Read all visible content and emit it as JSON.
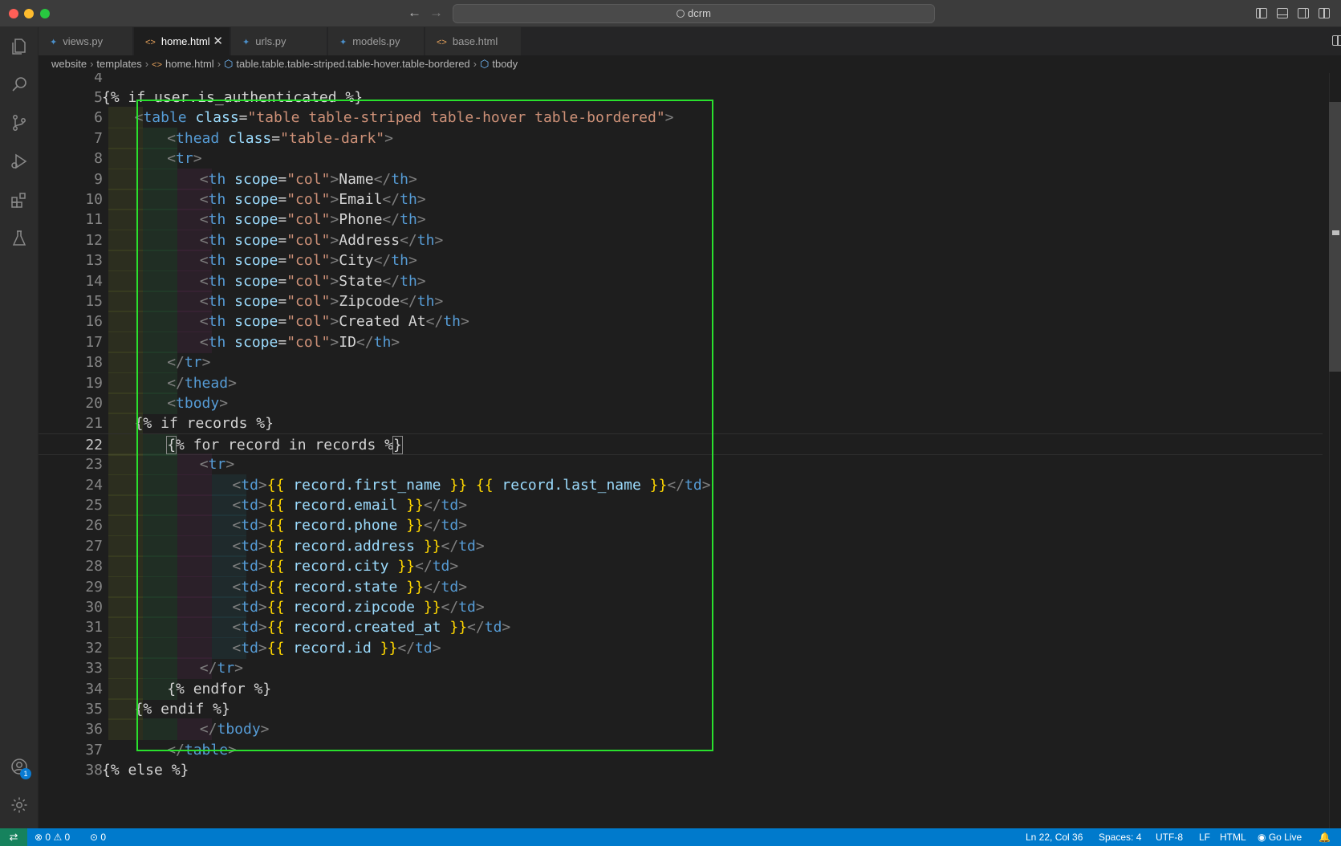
{
  "titlebar": {
    "search_text": "dcrm"
  },
  "tabs": [
    {
      "label": "views.py",
      "type": "py",
      "active": false
    },
    {
      "label": "home.html",
      "type": "html",
      "active": true
    },
    {
      "label": "urls.py",
      "type": "py",
      "active": false
    },
    {
      "label": "models.py",
      "type": "py",
      "active": false
    },
    {
      "label": "base.html",
      "type": "html",
      "active": false
    }
  ],
  "breadcrumbs": {
    "items": [
      "website",
      "templates",
      "home.html",
      "table.table.table-striped.table-hover.table-bordered",
      "tbody"
    ]
  },
  "editor": {
    "current_line": 22,
    "lines": [
      {
        "n": "4",
        "text": ""
      },
      {
        "n": "5",
        "text": "{% if user.is_authenticated %}"
      },
      {
        "n": "6",
        "text": "<table class=\"table table-striped table-hover table-bordered\">"
      },
      {
        "n": "7",
        "text": "<thead class=\"table-dark\">"
      },
      {
        "n": "8",
        "text": "<tr>"
      },
      {
        "n": "9",
        "text": "<th scope=\"col\">Name</th>"
      },
      {
        "n": "10",
        "text": "<th scope=\"col\">Email</th>"
      },
      {
        "n": "11",
        "text": "<th scope=\"col\">Phone</th>"
      },
      {
        "n": "12",
        "text": "<th scope=\"col\">Address</th>"
      },
      {
        "n": "13",
        "text": "<th scope=\"col\">City</th>"
      },
      {
        "n": "14",
        "text": "<th scope=\"col\">State</th>"
      },
      {
        "n": "15",
        "text": "<th scope=\"col\">Zipcode</th>"
      },
      {
        "n": "16",
        "text": "<th scope=\"col\">Created At</th>"
      },
      {
        "n": "17",
        "text": "<th scope=\"col\">ID</th>"
      },
      {
        "n": "18",
        "text": "</tr>"
      },
      {
        "n": "19",
        "text": "</thead>"
      },
      {
        "n": "20",
        "text": "<tbody>"
      },
      {
        "n": "21",
        "text": "{% if records %}"
      },
      {
        "n": "22",
        "text": "{% for record in records %}"
      },
      {
        "n": "23",
        "text": "<tr>"
      },
      {
        "n": "24",
        "text": "<td>{{ record.first_name }} {{ record.last_name }}</td>"
      },
      {
        "n": "25",
        "text": "<td>{{ record.email }}</td>"
      },
      {
        "n": "26",
        "text": "<td>{{ record.phone }}</td>"
      },
      {
        "n": "27",
        "text": "<td>{{ record.address }}</td>"
      },
      {
        "n": "28",
        "text": "<td>{{ record.city }}</td>"
      },
      {
        "n": "29",
        "text": "<td>{{ record.state }}</td>"
      },
      {
        "n": "30",
        "text": "<td>{{ record.zipcode }}</td>"
      },
      {
        "n": "31",
        "text": "<td>{{ record.created_at }}</td>"
      },
      {
        "n": "32",
        "text": "<td>{{ record.id }}</td>"
      },
      {
        "n": "33",
        "text": "</tr>"
      },
      {
        "n": "34",
        "text": "{% endfor %}"
      },
      {
        "n": "35",
        "text": "{% endif %}"
      },
      {
        "n": "36",
        "text": "</tbody>"
      },
      {
        "n": "37",
        "text": "</table>"
      },
      {
        "n": "38",
        "text": "{% else %}"
      }
    ]
  },
  "statusbar": {
    "errors": "0",
    "warnings": "0",
    "ports": "0",
    "position": "Ln 22, Col 36",
    "spaces": "Spaces: 4",
    "encoding": "UTF-8",
    "eol": "LF",
    "language": "HTML",
    "golive": "Go Live"
  },
  "activity": {
    "account_badge": "1"
  },
  "colors": {
    "highlight_box": "#29e02d",
    "statusbar": "#007acc",
    "tag": "#569cd6",
    "attr": "#9cdcfe",
    "string": "#ce9178",
    "brace": "#ffd700"
  },
  "icons": [
    "explorer-icon",
    "search-icon",
    "source-control-icon",
    "run-debug-icon",
    "extensions-icon",
    "testing-icon",
    "account-icon",
    "settings-gear-icon"
  ]
}
